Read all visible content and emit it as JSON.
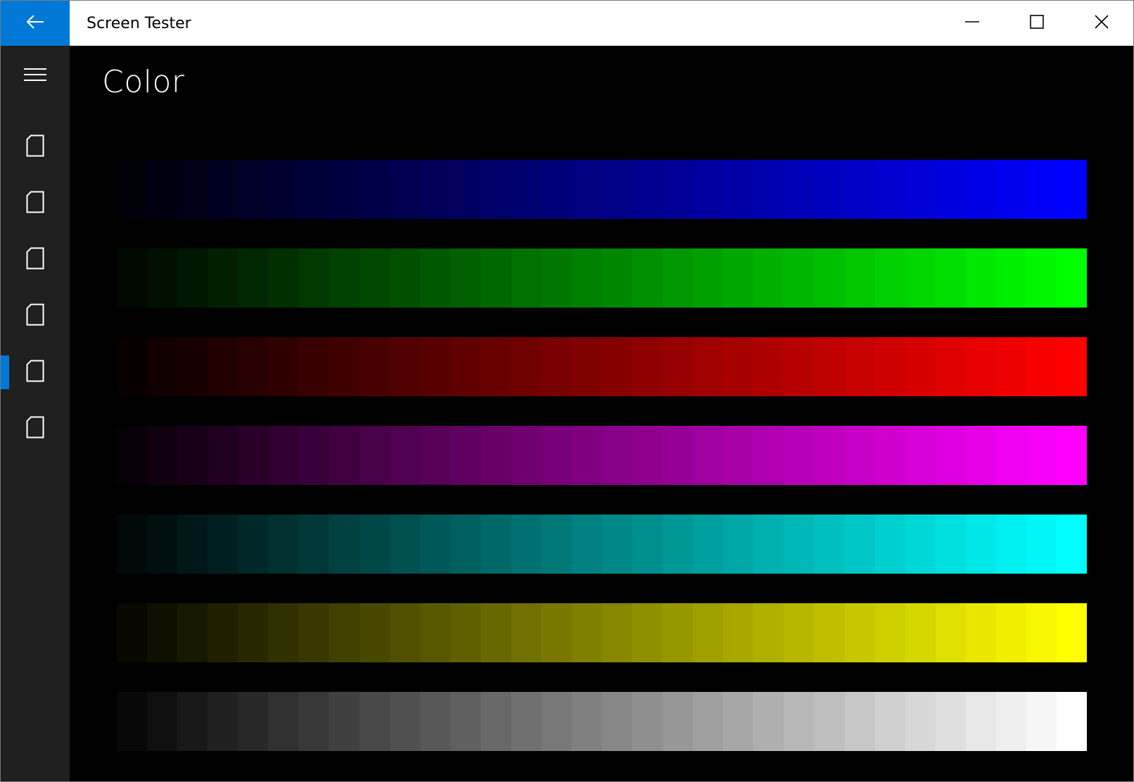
{
  "window": {
    "title": "Screen Tester"
  },
  "header": {
    "page_title": "Color"
  },
  "sidebar": {
    "items": [
      {
        "icon": "page-icon"
      },
      {
        "icon": "page-icon"
      },
      {
        "icon": "page-icon"
      },
      {
        "icon": "page-icon"
      },
      {
        "icon": "page-icon",
        "selected": true
      },
      {
        "icon": "page-icon"
      }
    ]
  },
  "colors": {
    "accent": "#0078d7",
    "sidebar_bg": "#1f1f1f",
    "content_bg": "#000000"
  },
  "color_bars": {
    "steps": 32,
    "bars": [
      {
        "name": "blue",
        "color": [
          0,
          0,
          255
        ]
      },
      {
        "name": "green",
        "color": [
          0,
          255,
          0
        ]
      },
      {
        "name": "red",
        "color": [
          255,
          0,
          0
        ]
      },
      {
        "name": "magenta",
        "color": [
          255,
          0,
          255
        ]
      },
      {
        "name": "cyan",
        "color": [
          0,
          255,
          255
        ]
      },
      {
        "name": "yellow",
        "color": [
          255,
          255,
          0
        ]
      },
      {
        "name": "gray",
        "color": [
          255,
          255,
          255
        ]
      }
    ]
  }
}
